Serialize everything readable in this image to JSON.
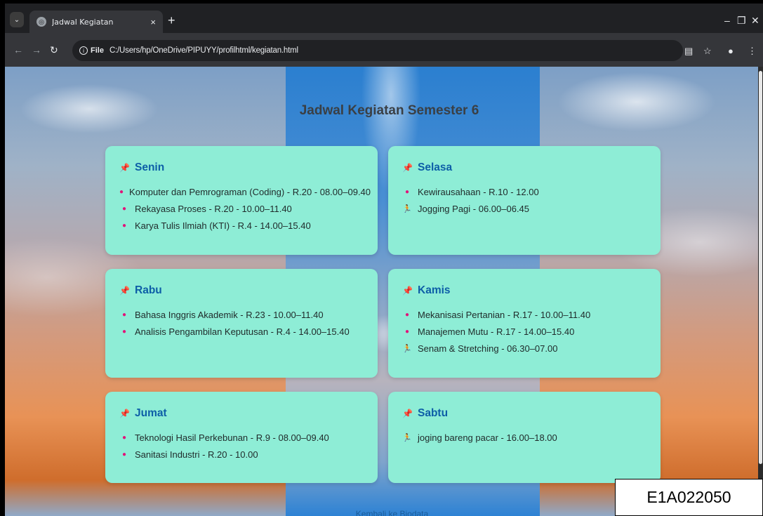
{
  "browser": {
    "tab_title": "Jadwal Kegiatan",
    "tab_close": "×",
    "new_tab": "+",
    "site_chip": "File",
    "url": "C:/Users/hp/OneDrive/PIPUYY/profilhtml/kegiatan.html"
  },
  "page": {
    "title": "Jadwal Kegiatan Semester 6",
    "back_link": "Kembali ke Biodata"
  },
  "days": [
    {
      "name": "Senin",
      "items": [
        {
          "text": "Komputer dan Pemrograman (Coding) - R.20 - 08.00–09.40",
          "icon": "bullet"
        },
        {
          "text": "Rekayasa Proses - R.20 - 10.00–11.40",
          "icon": "bullet"
        },
        {
          "text": "Karya Tulis Ilmiah (KTI) - R.4 - 14.00–15.40",
          "icon": "bullet"
        }
      ]
    },
    {
      "name": "Selasa",
      "items": [
        {
          "text": "Kewirausahaan - R.10 - 12.00",
          "icon": "bullet"
        },
        {
          "text": "Jogging Pagi - 06.00–06.45",
          "icon": "runner"
        }
      ]
    },
    {
      "name": "Rabu",
      "items": [
        {
          "text": "Bahasa Inggris Akademik - R.23 - 10.00–11.40",
          "icon": "bullet"
        },
        {
          "text": "Analisis Pengambilan Keputusan - R.4 - 14.00–15.40",
          "icon": "bullet"
        }
      ]
    },
    {
      "name": "Kamis",
      "items": [
        {
          "text": "Mekanisasi Pertanian - R.17 - 10.00–11.40",
          "icon": "bullet"
        },
        {
          "text": "Manajemen Mutu - R.17 - 14.00–15.40",
          "icon": "bullet"
        },
        {
          "text": "Senam & Stretching - 06.30–07.00",
          "icon": "runner"
        }
      ]
    },
    {
      "name": "Jumat",
      "items": [
        {
          "text": "Teknologi Hasil Perkebunan - R.9 - 08.00–09.40",
          "icon": "bullet"
        },
        {
          "text": "Sanitasi Industri - R.20 - 10.00",
          "icon": "bullet"
        }
      ]
    },
    {
      "name": "Sabtu",
      "items": [
        {
          "text": "joging bareng pacar - 16.00–18.00",
          "icon": "runner"
        }
      ]
    }
  ],
  "stamp": "E1A022050",
  "colors": {
    "card_bg": "#8eedd6",
    "day_title": "#0d5ea7",
    "pin": "#d9163b",
    "bullet": "#e0157a"
  }
}
